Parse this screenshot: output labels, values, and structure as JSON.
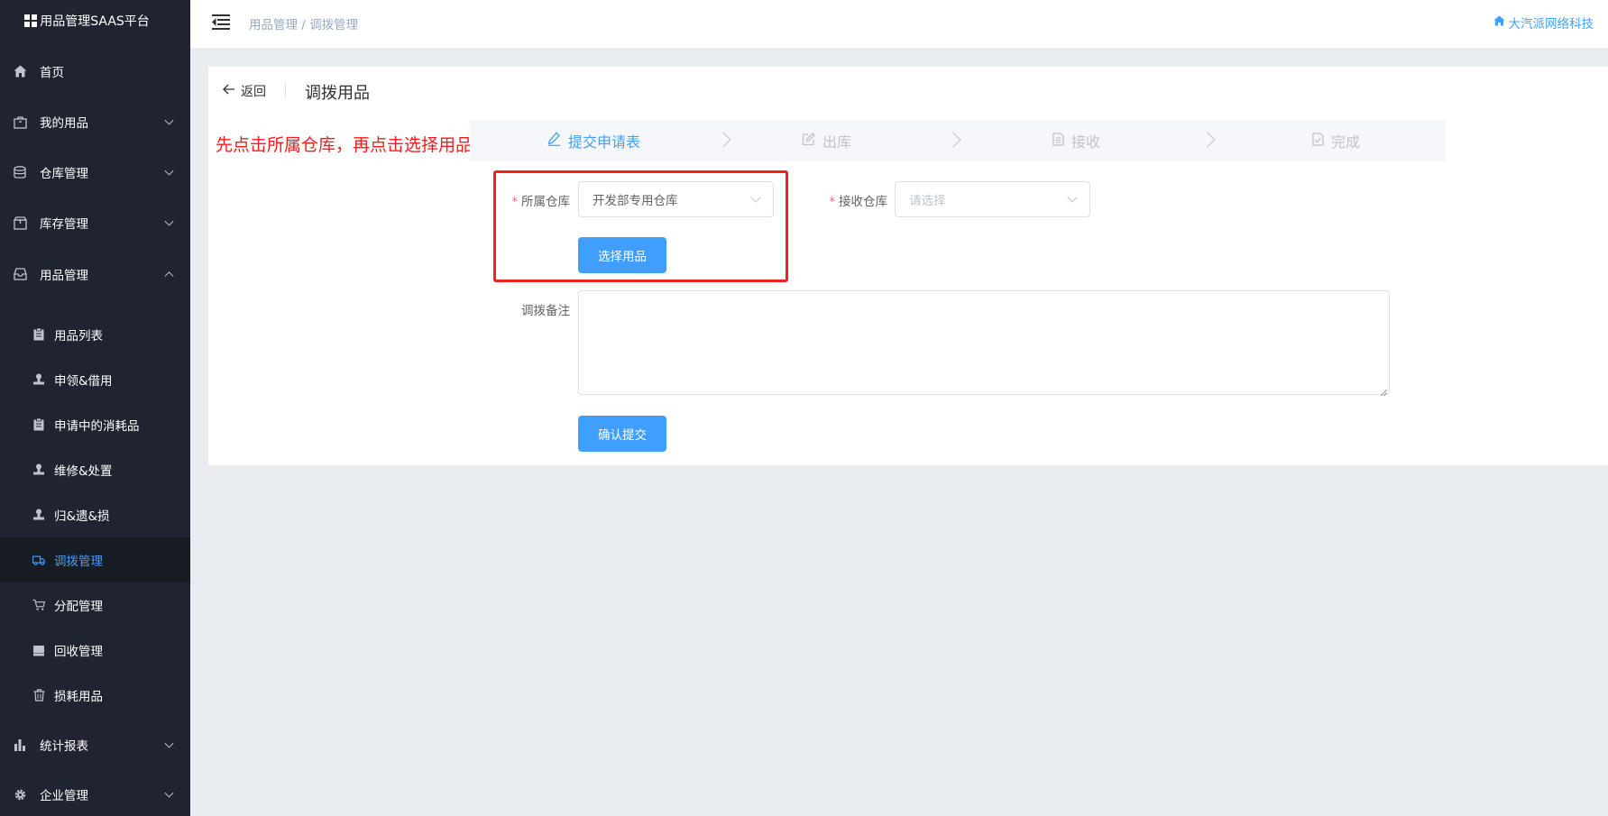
{
  "brand": {
    "title": "用品管理SAAS平台"
  },
  "sidebar": {
    "items": [
      {
        "label": "首页",
        "icon": "home-icon"
      },
      {
        "label": "我的用品",
        "icon": "bag-icon"
      },
      {
        "label": "仓库管理",
        "icon": "database-icon"
      },
      {
        "label": "库存管理",
        "icon": "box-icon"
      },
      {
        "label": "用品管理",
        "icon": "inbox-icon"
      },
      {
        "label": "统计报表",
        "icon": "bar-chart-icon"
      },
      {
        "label": "企业管理",
        "icon": "gear-icon"
      }
    ],
    "sub_items": [
      {
        "label": "用品列表",
        "icon": "clipboard-icon"
      },
      {
        "label": "申领&借用",
        "icon": "stamp-icon"
      },
      {
        "label": "申请中的消耗品",
        "icon": "clipboard-icon"
      },
      {
        "label": "维修&处置",
        "icon": "stamp-icon"
      },
      {
        "label": "归&遗&损",
        "icon": "stamp-icon"
      },
      {
        "label": "调拨管理",
        "icon": "truck-icon",
        "active": true
      },
      {
        "label": "分配管理",
        "icon": "cart-icon"
      },
      {
        "label": "回收管理",
        "icon": "drive-icon"
      },
      {
        "label": "损耗用品",
        "icon": "trash-icon"
      }
    ]
  },
  "header": {
    "breadcrumb": "用品管理 / 调拨管理",
    "company": "大汽派网络科技"
  },
  "page": {
    "back_label": "返回",
    "title": "调拨用品",
    "annotation": "先点击所属仓库，再点击选择用品"
  },
  "steps": [
    {
      "label": "提交申请表",
      "icon": "pencil-icon",
      "active": true
    },
    {
      "label": "出库",
      "icon": "edit-icon",
      "active": false
    },
    {
      "label": "接收",
      "icon": "document-icon",
      "active": false
    },
    {
      "label": "完成",
      "icon": "check-document-icon",
      "active": false
    }
  ],
  "form": {
    "source_warehouse_label": "所属仓库",
    "source_warehouse_value": "开发部专用仓库",
    "target_warehouse_label": "接收仓库",
    "target_warehouse_placeholder": "请选择",
    "select_items_button": "选择用品",
    "remark_label": "调拨备注",
    "remark_value": "",
    "submit_button": "确认提交",
    "required_mark": "*"
  },
  "colors": {
    "primary": "#409eff",
    "sidebar_bg": "#1f2430",
    "annotation_red": "#ff1a1a"
  }
}
